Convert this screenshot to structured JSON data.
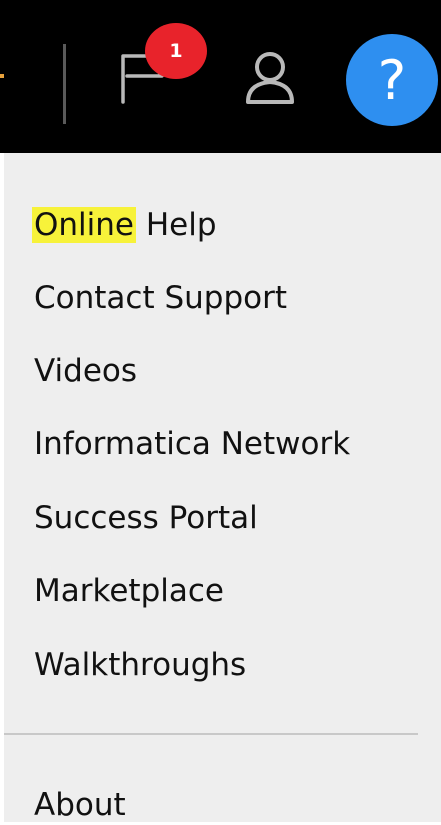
{
  "topbar": {
    "notification_count": "1",
    "help_symbol": "?",
    "icons": {
      "flag": "flag-icon",
      "user": "user-icon",
      "help": "question-mark-icon"
    },
    "colors": {
      "bar_background": "#000000",
      "badge": "#e8232b",
      "help_button": "#2e8ff0",
      "accent_orange": "#e8a23c"
    }
  },
  "help_menu": {
    "items": [
      {
        "highlight": "Online",
        "rest": " Help"
      },
      {
        "label": "Contact Support"
      },
      {
        "label": "Videos"
      },
      {
        "label": "Informatica Network"
      },
      {
        "label": "Success Portal"
      },
      {
        "label": "Marketplace"
      },
      {
        "label": "Walkthroughs"
      }
    ],
    "footer_item": "About",
    "colors": {
      "panel_background": "#eeeeee",
      "highlight": "#f7f23a"
    }
  }
}
